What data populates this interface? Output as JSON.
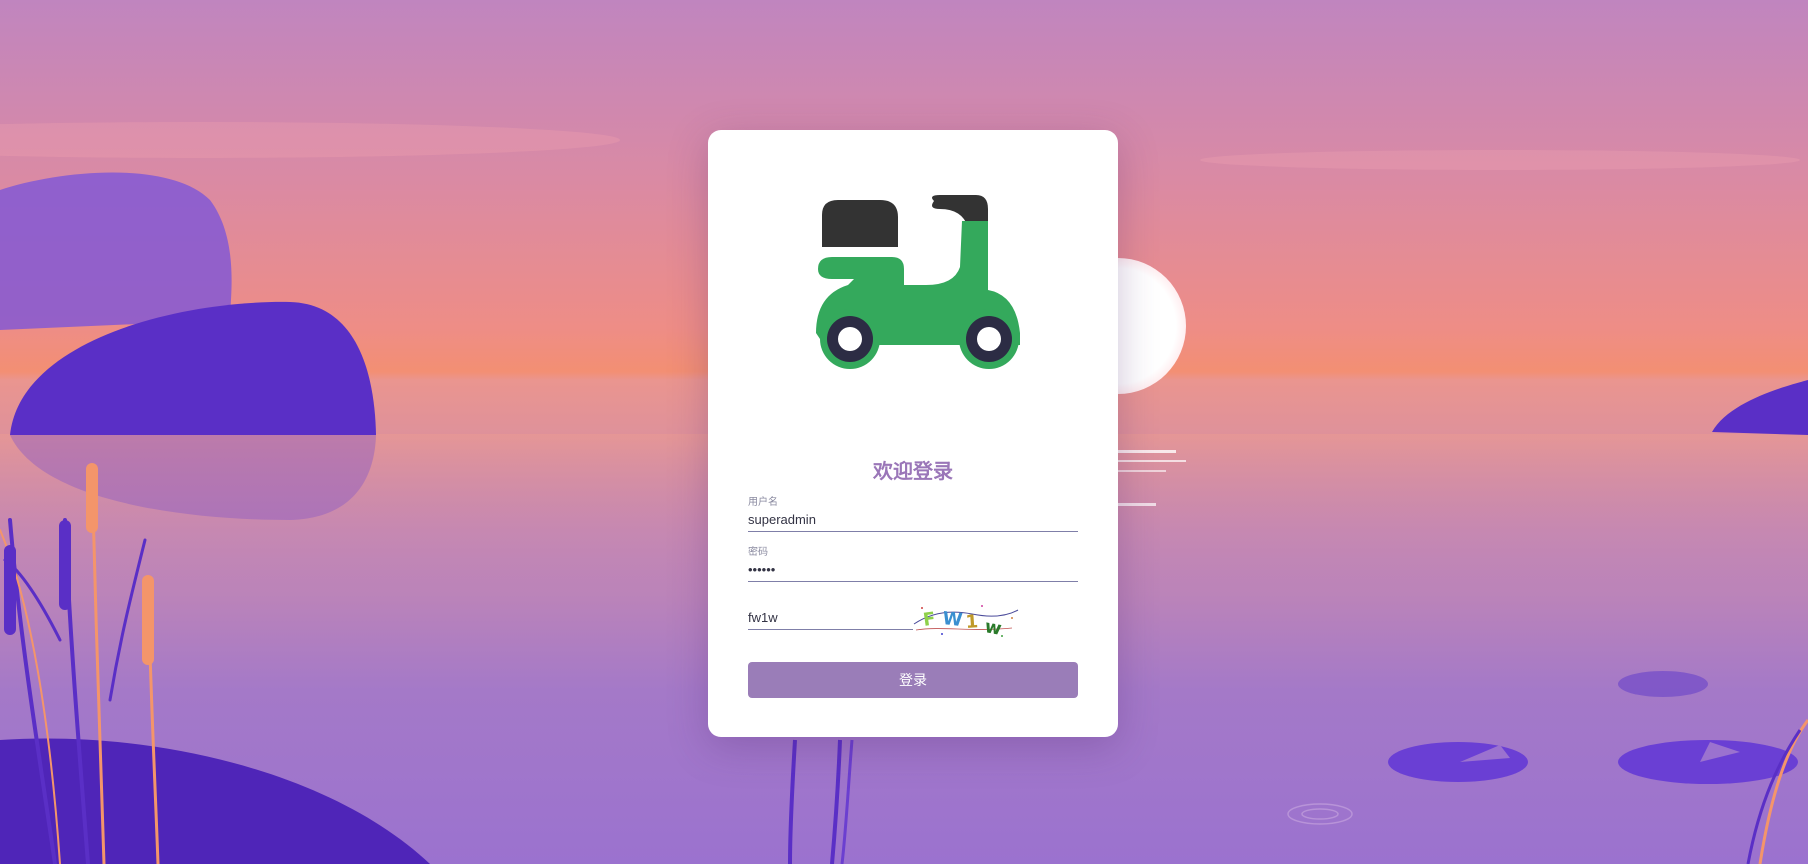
{
  "page": {
    "title": "欢迎登录"
  },
  "form": {
    "username": {
      "label": "用户名",
      "value": "superadmin"
    },
    "password": {
      "label": "密码",
      "value": "••••••"
    },
    "captcha": {
      "value": "fw1w",
      "image_text": "FW1w"
    },
    "submit_label": "登录"
  },
  "colors": {
    "accent": "#9a7db8",
    "scooter_body": "#34a95c",
    "scooter_dark": "#333333",
    "wheel_rim": "#2c2c44"
  },
  "icons": {
    "logo": "scooter-icon"
  }
}
